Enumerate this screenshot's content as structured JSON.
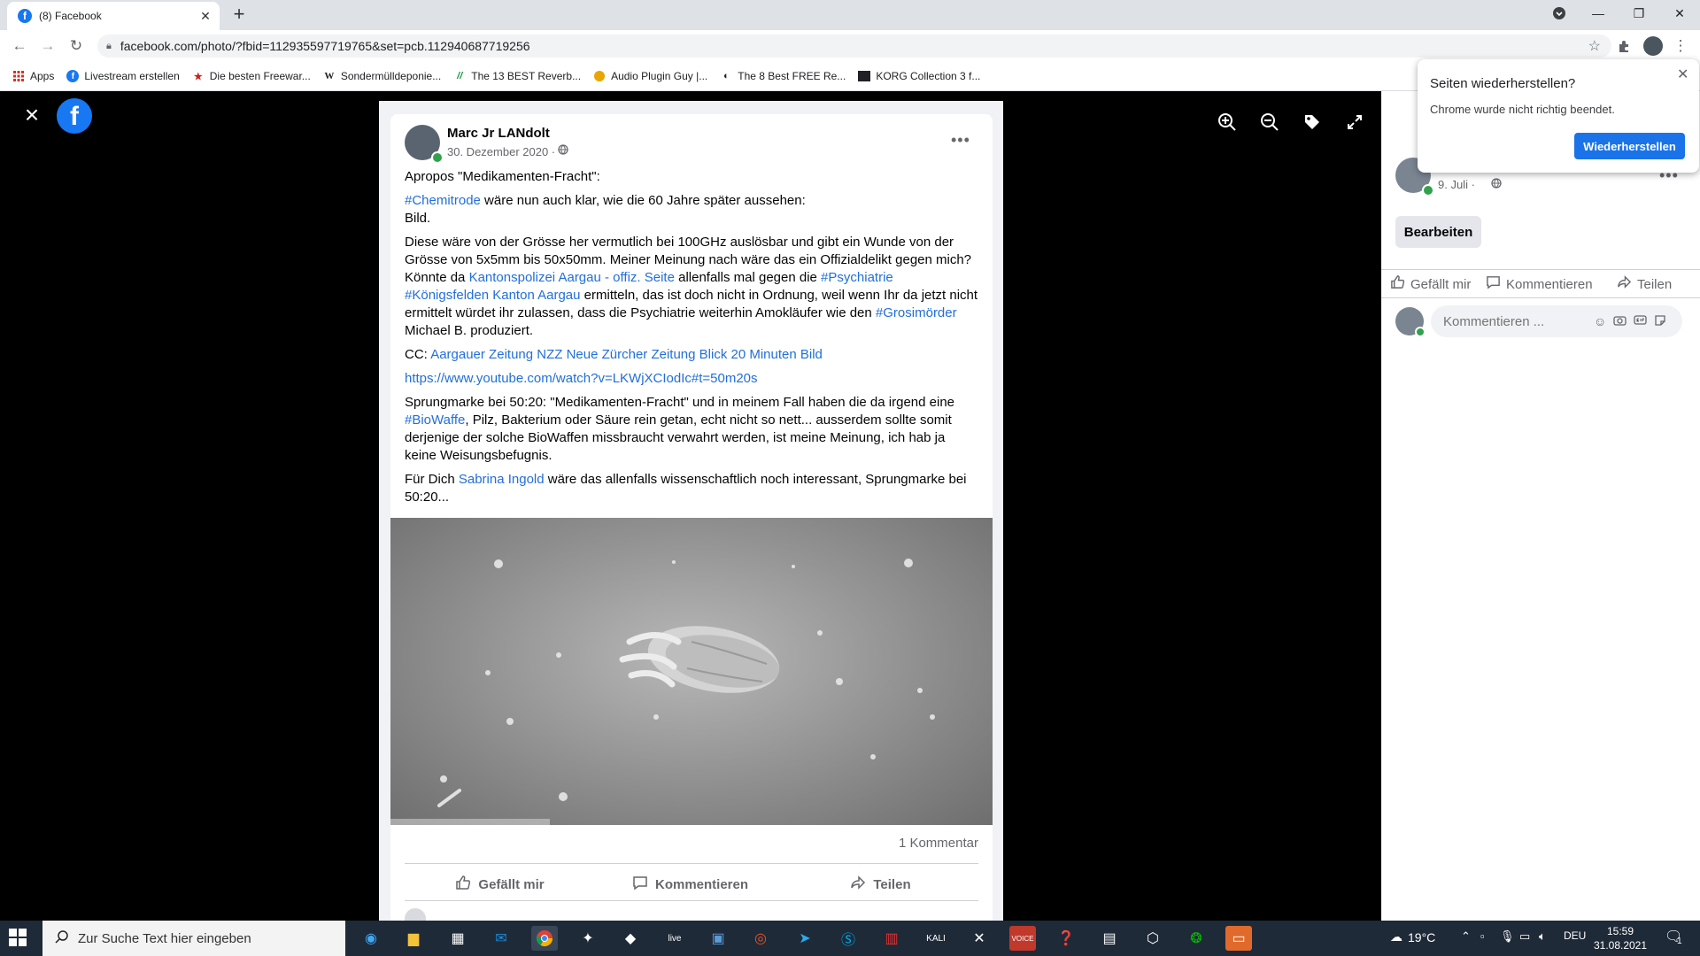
{
  "browser": {
    "tab_title": "(8) Facebook",
    "url": "facebook.com/photo/?fbid=112935597719765&set=pcb.112940687719256",
    "bookmarks": [
      {
        "label": "Apps",
        "icon": "apps-grid-icon"
      },
      {
        "label": "Livestream erstellen",
        "icon": "facebook-icon"
      },
      {
        "label": "Die besten Freewar...",
        "icon": "star-icon"
      },
      {
        "label": "Sondermülldeponie...",
        "icon": "wikipedia-icon"
      },
      {
        "label": "The 13 BEST Reverb...",
        "icon": "reverb-icon"
      },
      {
        "label": "Audio Plugin Guy |...",
        "icon": "plugin-guy-icon"
      },
      {
        "label": "The 8 Best FREE Re...",
        "icon": "moon-icon"
      },
      {
        "label": "KORG Collection 3 f...",
        "icon": "korg-icon"
      }
    ]
  },
  "restore_popup": {
    "title": "Seiten wiederherstellen?",
    "text": "Chrome wurde nicht richtig beendet.",
    "button": "Wiederherstellen"
  },
  "post": {
    "author": "Marc Jr LANdolt",
    "date": "30. Dezember 2020 ·",
    "comment_count": "1 Kommentar",
    "actions": {
      "like": "Gefällt mir",
      "comment": "Kommentieren",
      "share": "Teilen"
    },
    "p1": "Apropos \"Medikamenten-Fracht\":",
    "p2_link": "#Chemitrode",
    "p2_text": " wäre nun auch klar, wie die 60 Jahre später aussehen:",
    "p2_line2": "Bild.",
    "p3_a": "Diese wäre von der Grösse her vermutlich bei 100GHz auslösbar und gibt ein Wunde von der Grösse von 5x5mm bis 50x50mm. Meiner Meinung nach wäre das ein Offizialdelikt gegen mich? Könnte da ",
    "p3_link1": "Kantonspolizei Aargau - offiz. Seite",
    "p3_b": " allenfalls mal gegen die ",
    "p3_link2": "#Psychiatrie",
    "p3_link3": "#Königsfelden Kanton Aargau",
    "p3_c": " ermitteln, das ist doch nicht in Ordnung, weil wenn Ihr da jetzt nicht ermittelt würdet ihr zulassen, dass die Psychiatrie weiterhin Amokläufer wie den ",
    "p3_link4": "#Grosimörder",
    "p3_d": " Michael B. produziert.",
    "p4_prefix": "CC: ",
    "p4_links": "Aargauer Zeitung NZZ Neue Zürcher Zeitung Blick 20 Minuten Bild",
    "p5_link": "https://www.youtube.com/watch?v=LKWjXCIodIc#t=50m20s",
    "p6_a": "Sprungmarke bei 50:20: \"Medikamenten-Fracht\" und in meinem Fall haben die da irgend eine ",
    "p6_link": "#BioWaffe",
    "p6_b": ", Pilz, Bakterium oder Säure rein getan, echt nicht so nett... ausserdem sollte somit derjenige der solche BioWaffen missbraucht verwahrt werden, ist meine Meinung, ich hab ja keine Weisungsbefugnis.",
    "p7_a": "Für Dich ",
    "p7_link": "Sabrina Ingold",
    "p7_b": " wäre das allenfalls wissenschaftlich noch interessant, Sprungmarke bei 50:20..."
  },
  "side_panel": {
    "date": "9. Juli ·",
    "edit_button": "Bearbeiten",
    "actions": {
      "like": "Gefällt mir",
      "comment": "Kommentieren",
      "share": "Teilen"
    },
    "comment_placeholder": "Kommentieren ..."
  },
  "taskbar": {
    "search_placeholder": "Zur Suche Text hier eingeben",
    "weather": "19°C",
    "language": "DEU",
    "time": "15:59",
    "date": "31.08.2021",
    "notification_count": "1"
  }
}
